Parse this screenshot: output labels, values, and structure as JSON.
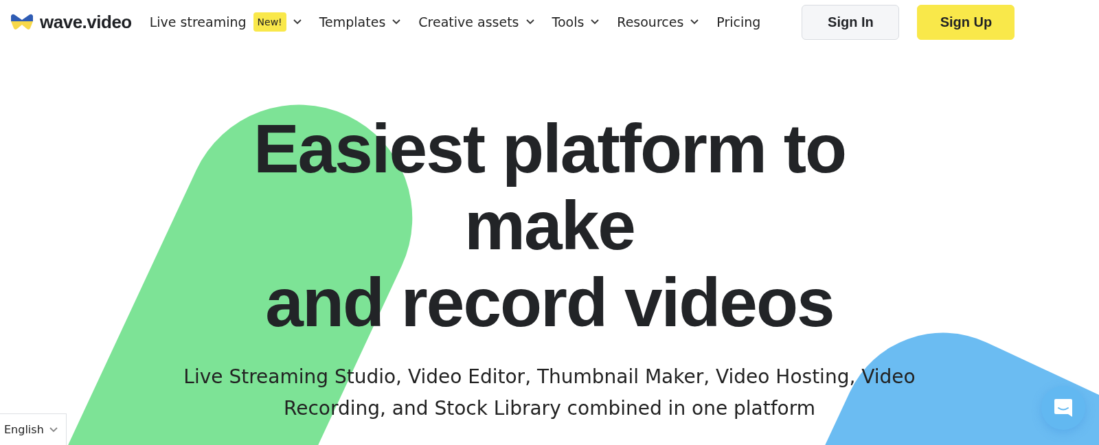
{
  "header": {
    "logo": "wave.video",
    "nav": [
      {
        "label": "Live streaming",
        "badge": "New!",
        "dropdown": true
      },
      {
        "label": "Templates",
        "dropdown": true
      },
      {
        "label": "Creative assets",
        "dropdown": true
      },
      {
        "label": "Tools",
        "dropdown": true
      },
      {
        "label": "Resources",
        "dropdown": true
      },
      {
        "label": "Pricing",
        "dropdown": false
      }
    ],
    "buttons": [
      {
        "label": "Sign In",
        "kind": "secondary"
      },
      {
        "label": "Sign Up",
        "kind": "primary"
      }
    ]
  },
  "hero": {
    "headline": [
      "Easiest platform to",
      "make",
      "and record videos"
    ],
    "subtitle": "Live Streaming Studio, Video Editor, Thumbnail Maker, Video Hosting, Video Recording, and Stock Library combined in one platform"
  },
  "language": {
    "value": "English"
  }
}
